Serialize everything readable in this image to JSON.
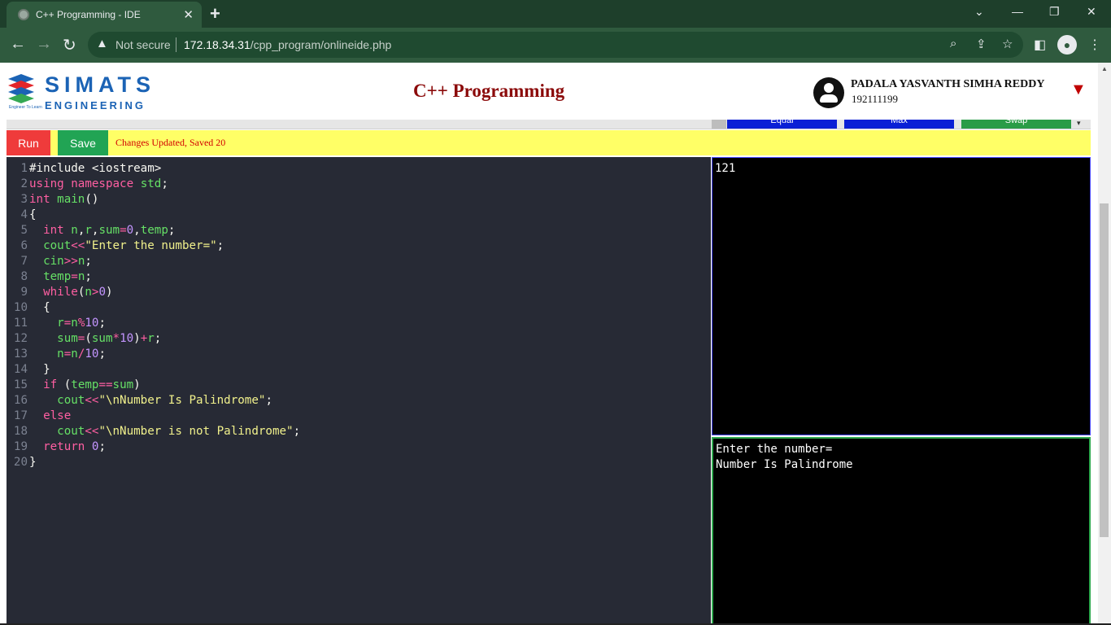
{
  "browser": {
    "tab_title": "C++ Programming - IDE",
    "security_label": "Not secure",
    "url_host": "172.18.34.31",
    "url_path": "/cpp_program/onlineide.php"
  },
  "header": {
    "brand_line1": "SIMATS",
    "brand_line2": "ENGINEERING",
    "brand_tagline": "Engineer To Learn",
    "page_title": "C++ Programming",
    "user_name": "PADALA YASVANTH SIMHA REDDY",
    "user_id": "192111199"
  },
  "toolbar": {
    "hidden_buttons": [
      "Equal",
      "Max",
      "Swap"
    ],
    "run_label": "Run",
    "save_label": "Save",
    "status_message": "Changes Updated, Saved 20"
  },
  "editor": {
    "lines": [
      {
        "num": "1",
        "tokens": [
          [
            "pre",
            "#include <iostream>"
          ]
        ]
      },
      {
        "num": "2",
        "tokens": [
          [
            "kw",
            "using"
          ],
          [
            "pun",
            " "
          ],
          [
            "kw",
            "namespace"
          ],
          [
            "pun",
            " "
          ],
          [
            "id",
            "std"
          ],
          [
            "pun",
            ";"
          ]
        ]
      },
      {
        "num": "3",
        "tokens": [
          [
            "ty",
            "int"
          ],
          [
            "pun",
            " "
          ],
          [
            "id",
            "main"
          ],
          [
            "pun",
            "()"
          ]
        ]
      },
      {
        "num": "4",
        "tokens": [
          [
            "pun",
            "{"
          ]
        ]
      },
      {
        "num": "5",
        "tokens": [
          [
            "pun",
            "  "
          ],
          [
            "ty",
            "int"
          ],
          [
            "pun",
            " "
          ],
          [
            "id",
            "n"
          ],
          [
            "pun",
            ","
          ],
          [
            "id",
            "r"
          ],
          [
            "pun",
            ","
          ],
          [
            "id",
            "sum"
          ],
          [
            "op",
            "="
          ],
          [
            "num",
            "0"
          ],
          [
            "pun",
            ","
          ],
          [
            "id",
            "temp"
          ],
          [
            "pun",
            ";"
          ]
        ]
      },
      {
        "num": "6",
        "tokens": [
          [
            "pun",
            "  "
          ],
          [
            "id",
            "cout"
          ],
          [
            "op",
            "<<"
          ],
          [
            "str",
            "\"Enter the number=\""
          ],
          [
            "pun",
            ";"
          ]
        ]
      },
      {
        "num": "7",
        "tokens": [
          [
            "pun",
            "  "
          ],
          [
            "id",
            "cin"
          ],
          [
            "op",
            ">>"
          ],
          [
            "id",
            "n"
          ],
          [
            "pun",
            ";"
          ]
        ]
      },
      {
        "num": "8",
        "tokens": [
          [
            "pun",
            "  "
          ],
          [
            "id",
            "temp"
          ],
          [
            "op",
            "="
          ],
          [
            "id",
            "n"
          ],
          [
            "pun",
            ";"
          ]
        ]
      },
      {
        "num": "9",
        "tokens": [
          [
            "pun",
            "  "
          ],
          [
            "kw",
            "while"
          ],
          [
            "pun",
            "("
          ],
          [
            "id",
            "n"
          ],
          [
            "op",
            ">"
          ],
          [
            "num",
            "0"
          ],
          [
            "pun",
            ")"
          ]
        ]
      },
      {
        "num": "10",
        "tokens": [
          [
            "pun",
            "  {"
          ]
        ]
      },
      {
        "num": "11",
        "tokens": [
          [
            "pun",
            "    "
          ],
          [
            "id",
            "r"
          ],
          [
            "op",
            "="
          ],
          [
            "id",
            "n"
          ],
          [
            "op",
            "%"
          ],
          [
            "num",
            "10"
          ],
          [
            "pun",
            ";"
          ]
        ]
      },
      {
        "num": "12",
        "tokens": [
          [
            "pun",
            "    "
          ],
          [
            "id",
            "sum"
          ],
          [
            "op",
            "="
          ],
          [
            "pun",
            "("
          ],
          [
            "id",
            "sum"
          ],
          [
            "op",
            "*"
          ],
          [
            "num",
            "10"
          ],
          [
            "pun",
            ")"
          ],
          [
            "op",
            "+"
          ],
          [
            "id",
            "r"
          ],
          [
            "pun",
            ";"
          ]
        ]
      },
      {
        "num": "13",
        "tokens": [
          [
            "pun",
            "    "
          ],
          [
            "id",
            "n"
          ],
          [
            "op",
            "="
          ],
          [
            "id",
            "n"
          ],
          [
            "op",
            "/"
          ],
          [
            "num",
            "10"
          ],
          [
            "pun",
            ";"
          ]
        ]
      },
      {
        "num": "14",
        "tokens": [
          [
            "pun",
            "  }"
          ]
        ]
      },
      {
        "num": "15",
        "tokens": [
          [
            "pun",
            "  "
          ],
          [
            "kw",
            "if"
          ],
          [
            "pun",
            " ("
          ],
          [
            "id",
            "temp"
          ],
          [
            "op",
            "=="
          ],
          [
            "id",
            "sum"
          ],
          [
            "pun",
            ")"
          ]
        ]
      },
      {
        "num": "16",
        "tokens": [
          [
            "pun",
            "    "
          ],
          [
            "id",
            "cout"
          ],
          [
            "op",
            "<<"
          ],
          [
            "str",
            "\"\\nNumber Is Palindrome\""
          ],
          [
            "pun",
            ";"
          ]
        ]
      },
      {
        "num": "17",
        "tokens": [
          [
            "pun",
            "  "
          ],
          [
            "kw",
            "else"
          ]
        ]
      },
      {
        "num": "18",
        "tokens": [
          [
            "pun",
            "    "
          ],
          [
            "id",
            "cout"
          ],
          [
            "op",
            "<<"
          ],
          [
            "str",
            "\"\\nNumber is not Palindrome\""
          ],
          [
            "pun",
            ";"
          ]
        ]
      },
      {
        "num": "19",
        "tokens": [
          [
            "pun",
            "  "
          ],
          [
            "kw",
            "return"
          ],
          [
            "pun",
            " "
          ],
          [
            "num",
            "0"
          ],
          [
            "pun",
            ";"
          ]
        ]
      },
      {
        "num": "20",
        "tokens": [
          [
            "pun",
            "}"
          ]
        ]
      }
    ]
  },
  "io": {
    "input_text": "121",
    "output_text": "Enter the number=\nNumber Is Palindrome"
  },
  "colors": {
    "editor_bg": "#272a35",
    "run_button": "#ef3b3b",
    "save_button": "#21a454",
    "status_bar": "#ffff66"
  }
}
